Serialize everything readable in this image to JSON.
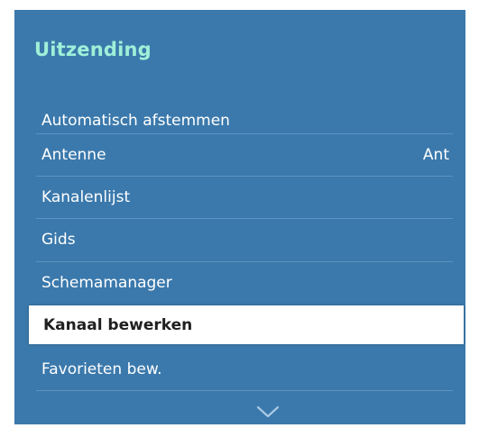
{
  "menu": {
    "title": "Uitzending",
    "items": [
      {
        "label": "Automatisch afstemmen",
        "value": ""
      },
      {
        "label": "Antenne",
        "value": "Ant"
      },
      {
        "label": "Kanalenlijst",
        "value": ""
      },
      {
        "label": "Gids",
        "value": ""
      },
      {
        "label": "Schemamanager",
        "value": ""
      },
      {
        "label": "Kanaal bewerken",
        "value": "",
        "selected": true
      },
      {
        "label": "Favorieten bew.",
        "value": ""
      }
    ],
    "scroll_icon": "chevron-down-icon"
  },
  "colors": {
    "panel_background": "#3b79ac",
    "title_color": "#9ff0d8",
    "item_text": "#ffffff",
    "selected_background": "#ffffff",
    "selected_text": "#1f1f1f",
    "divider": "#5d93c0"
  }
}
